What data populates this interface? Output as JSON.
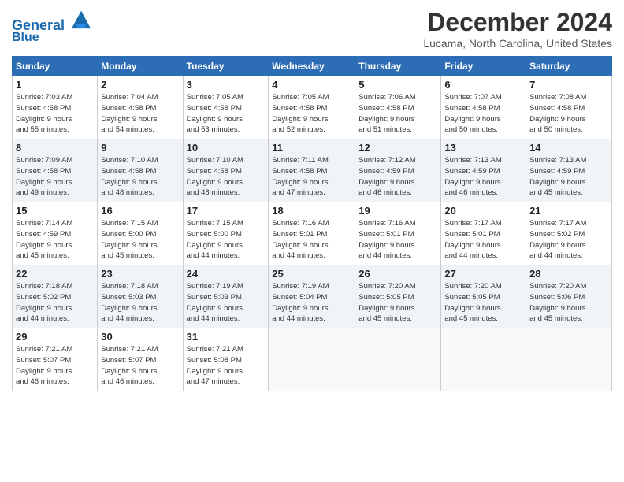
{
  "logo": {
    "line1": "General",
    "line2": "Blue"
  },
  "title": "December 2024",
  "location": "Lucama, North Carolina, United States",
  "days_of_week": [
    "Sunday",
    "Monday",
    "Tuesday",
    "Wednesday",
    "Thursday",
    "Friday",
    "Saturday"
  ],
  "weeks": [
    [
      {
        "num": "1",
        "info": "Sunrise: 7:03 AM\nSunset: 4:58 PM\nDaylight: 9 hours\nand 55 minutes."
      },
      {
        "num": "2",
        "info": "Sunrise: 7:04 AM\nSunset: 4:58 PM\nDaylight: 9 hours\nand 54 minutes."
      },
      {
        "num": "3",
        "info": "Sunrise: 7:05 AM\nSunset: 4:58 PM\nDaylight: 9 hours\nand 53 minutes."
      },
      {
        "num": "4",
        "info": "Sunrise: 7:05 AM\nSunset: 4:58 PM\nDaylight: 9 hours\nand 52 minutes."
      },
      {
        "num": "5",
        "info": "Sunrise: 7:06 AM\nSunset: 4:58 PM\nDaylight: 9 hours\nand 51 minutes."
      },
      {
        "num": "6",
        "info": "Sunrise: 7:07 AM\nSunset: 4:58 PM\nDaylight: 9 hours\nand 50 minutes."
      },
      {
        "num": "7",
        "info": "Sunrise: 7:08 AM\nSunset: 4:58 PM\nDaylight: 9 hours\nand 50 minutes."
      }
    ],
    [
      {
        "num": "8",
        "info": "Sunrise: 7:09 AM\nSunset: 4:58 PM\nDaylight: 9 hours\nand 49 minutes."
      },
      {
        "num": "9",
        "info": "Sunrise: 7:10 AM\nSunset: 4:58 PM\nDaylight: 9 hours\nand 48 minutes."
      },
      {
        "num": "10",
        "info": "Sunrise: 7:10 AM\nSunset: 4:58 PM\nDaylight: 9 hours\nand 48 minutes."
      },
      {
        "num": "11",
        "info": "Sunrise: 7:11 AM\nSunset: 4:58 PM\nDaylight: 9 hours\nand 47 minutes."
      },
      {
        "num": "12",
        "info": "Sunrise: 7:12 AM\nSunset: 4:59 PM\nDaylight: 9 hours\nand 46 minutes."
      },
      {
        "num": "13",
        "info": "Sunrise: 7:13 AM\nSunset: 4:59 PM\nDaylight: 9 hours\nand 46 minutes."
      },
      {
        "num": "14",
        "info": "Sunrise: 7:13 AM\nSunset: 4:59 PM\nDaylight: 9 hours\nand 45 minutes."
      }
    ],
    [
      {
        "num": "15",
        "info": "Sunrise: 7:14 AM\nSunset: 4:59 PM\nDaylight: 9 hours\nand 45 minutes."
      },
      {
        "num": "16",
        "info": "Sunrise: 7:15 AM\nSunset: 5:00 PM\nDaylight: 9 hours\nand 45 minutes."
      },
      {
        "num": "17",
        "info": "Sunrise: 7:15 AM\nSunset: 5:00 PM\nDaylight: 9 hours\nand 44 minutes."
      },
      {
        "num": "18",
        "info": "Sunrise: 7:16 AM\nSunset: 5:01 PM\nDaylight: 9 hours\nand 44 minutes."
      },
      {
        "num": "19",
        "info": "Sunrise: 7:16 AM\nSunset: 5:01 PM\nDaylight: 9 hours\nand 44 minutes."
      },
      {
        "num": "20",
        "info": "Sunrise: 7:17 AM\nSunset: 5:01 PM\nDaylight: 9 hours\nand 44 minutes."
      },
      {
        "num": "21",
        "info": "Sunrise: 7:17 AM\nSunset: 5:02 PM\nDaylight: 9 hours\nand 44 minutes."
      }
    ],
    [
      {
        "num": "22",
        "info": "Sunrise: 7:18 AM\nSunset: 5:02 PM\nDaylight: 9 hours\nand 44 minutes."
      },
      {
        "num": "23",
        "info": "Sunrise: 7:18 AM\nSunset: 5:03 PM\nDaylight: 9 hours\nand 44 minutes."
      },
      {
        "num": "24",
        "info": "Sunrise: 7:19 AM\nSunset: 5:03 PM\nDaylight: 9 hours\nand 44 minutes."
      },
      {
        "num": "25",
        "info": "Sunrise: 7:19 AM\nSunset: 5:04 PM\nDaylight: 9 hours\nand 44 minutes."
      },
      {
        "num": "26",
        "info": "Sunrise: 7:20 AM\nSunset: 5:05 PM\nDaylight: 9 hours\nand 45 minutes."
      },
      {
        "num": "27",
        "info": "Sunrise: 7:20 AM\nSunset: 5:05 PM\nDaylight: 9 hours\nand 45 minutes."
      },
      {
        "num": "28",
        "info": "Sunrise: 7:20 AM\nSunset: 5:06 PM\nDaylight: 9 hours\nand 45 minutes."
      }
    ],
    [
      {
        "num": "29",
        "info": "Sunrise: 7:21 AM\nSunset: 5:07 PM\nDaylight: 9 hours\nand 46 minutes."
      },
      {
        "num": "30",
        "info": "Sunrise: 7:21 AM\nSunset: 5:07 PM\nDaylight: 9 hours\nand 46 minutes."
      },
      {
        "num": "31",
        "info": "Sunrise: 7:21 AM\nSunset: 5:08 PM\nDaylight: 9 hours\nand 47 minutes."
      },
      null,
      null,
      null,
      null
    ]
  ]
}
